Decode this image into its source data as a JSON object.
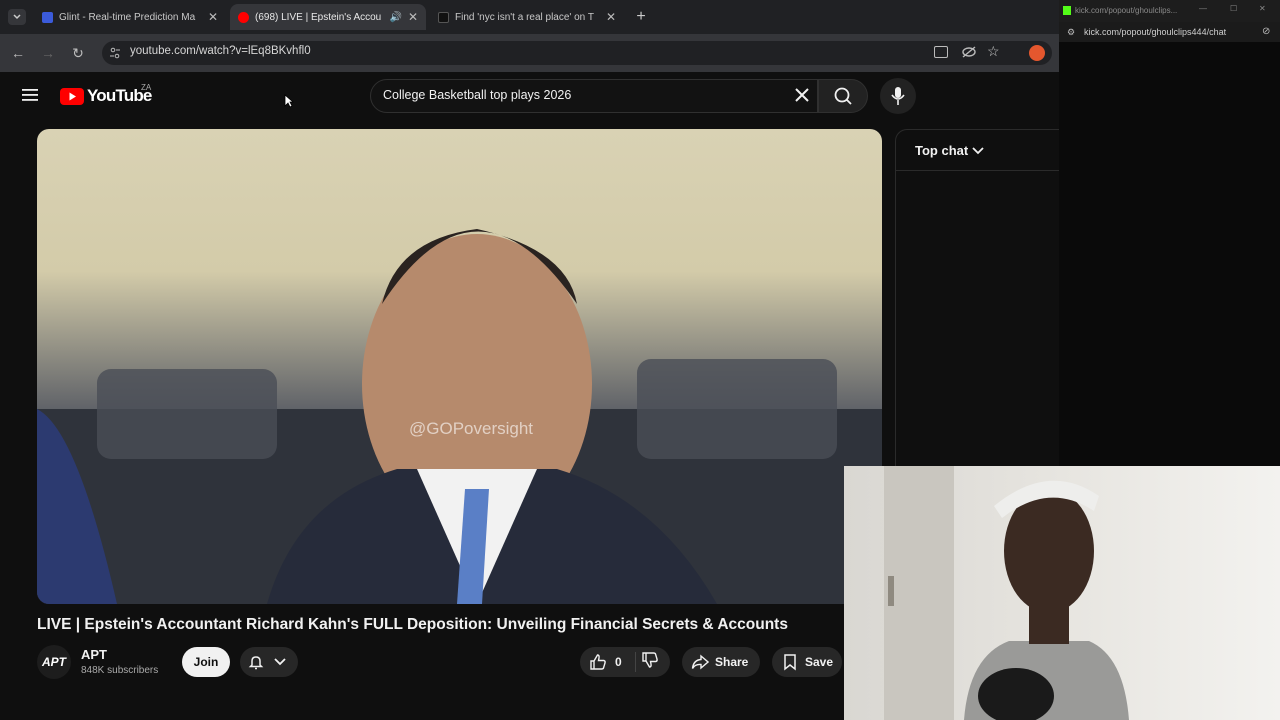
{
  "browser": {
    "tabs": [
      {
        "title": "Glint - Real-time Prediction Ma",
        "active": false
      },
      {
        "title": "(698) LIVE | Epstein's Accou",
        "active": true
      },
      {
        "title": "Find 'nyc isn't a real place' on T",
        "active": false
      }
    ],
    "url": "youtube.com/watch?v=lEq8BKvhfl0"
  },
  "popout": {
    "title_url": "kick.com/popout/ghoulclips...",
    "url": "kick.com/popout/ghoulclips444/chat"
  },
  "youtube": {
    "logo_text": "YouTube",
    "country": "ZA",
    "search_value": "College Basketball top plays 2026"
  },
  "video": {
    "watermark": "@GOPoversight",
    "title": "LIVE | Epstein's Accountant Richard Kahn's FULL Deposition: Unveiling Financial Secrets & Accounts"
  },
  "channel": {
    "avatar_text": "APT",
    "name": "APT",
    "subscribers": "848K subscribers",
    "join_label": "Join"
  },
  "actions": {
    "like_count": "0",
    "share_label": "Share",
    "save_label": "Save"
  },
  "chat": {
    "mode_label": "Top chat"
  },
  "colors": {
    "youtube_red": "#ff0000",
    "background": "#0f0f0f",
    "pill": "#272727"
  }
}
